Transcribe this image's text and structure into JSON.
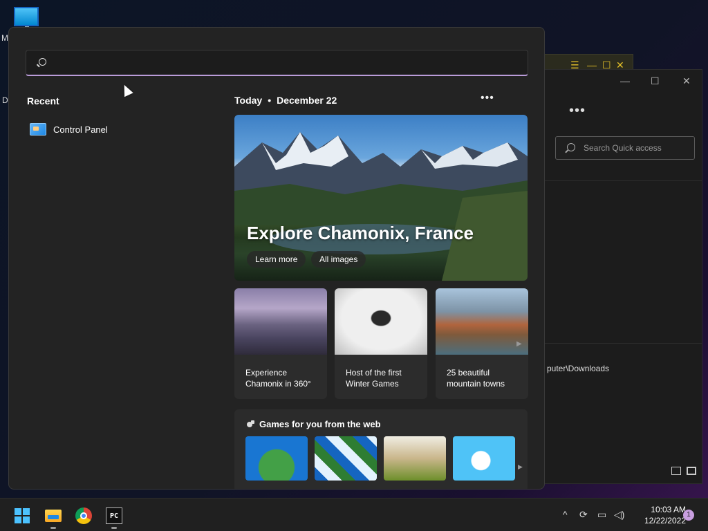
{
  "desktop": {
    "label_m": "M",
    "label_d": "Da"
  },
  "explorer": {
    "search_placeholder": "Search Quick access",
    "path_fragment": "puter\\Downloads",
    "more": "•••",
    "minimize": "—",
    "maximize": "☐",
    "close": "✕"
  },
  "start_menu": {
    "search": {
      "value": "",
      "placeholder": ""
    },
    "recent": {
      "heading": "Recent",
      "items": [
        {
          "label": "Control Panel",
          "icon": "control-panel-icon"
        }
      ]
    },
    "today": {
      "label": "Today",
      "separator": "•",
      "date": "December 22",
      "more": "•••"
    },
    "hero": {
      "title": "Explore Chamonix, France",
      "buttons": [
        "Learn more",
        "All images"
      ]
    },
    "cards": [
      {
        "caption": "Experience Chamonix in 360°"
      },
      {
        "caption": "Host of the first Winter Games"
      },
      {
        "caption": "25 beautiful mountain towns"
      }
    ],
    "games": {
      "heading": "Games for you from the web"
    }
  },
  "taskbar": {
    "apps": [
      "start-icon",
      "file-explorer-icon",
      "chrome-icon",
      "pycharm-icon"
    ],
    "pc_label": "PC",
    "tray": {
      "chevron": "^",
      "time": "10:03 AM",
      "date": "12/22/2022",
      "notifications": "1"
    }
  },
  "colors": {
    "accent": "#b99bd8",
    "panel": "#232323",
    "start_blue": "#4cc2ff"
  }
}
